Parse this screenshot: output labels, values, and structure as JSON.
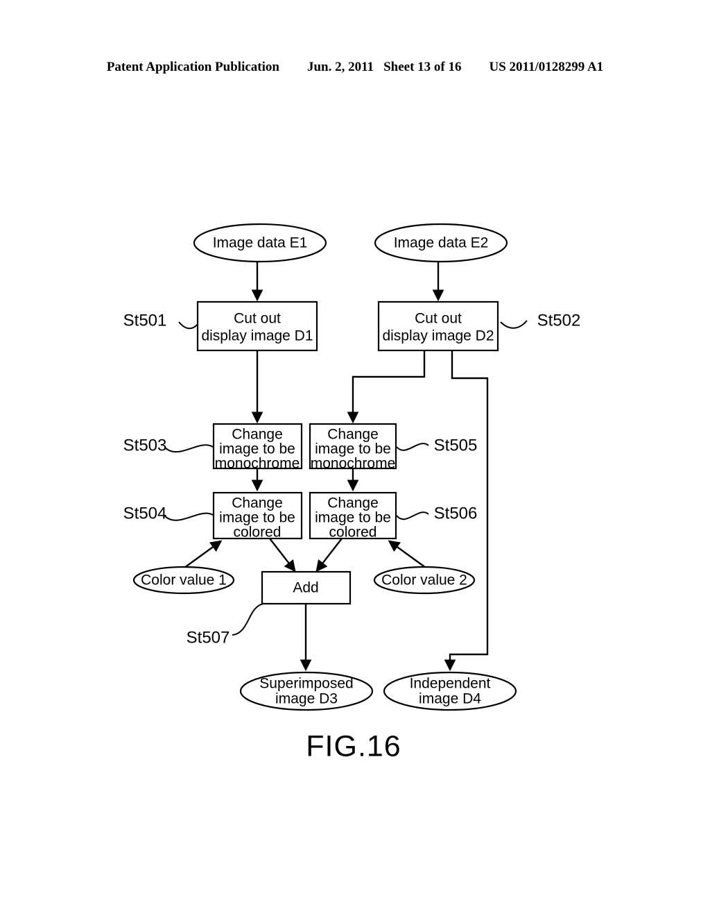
{
  "header": {
    "publication": "Patent Application Publication",
    "date": "Jun. 2, 2011",
    "sheet": "Sheet 13 of 16",
    "number": "US 2011/0128299 A1"
  },
  "figure": {
    "caption": "FIG.16"
  },
  "chart_data": {
    "type": "diagram",
    "title": "FIG.16",
    "nodes": [
      {
        "id": "e1",
        "shape": "ellipse",
        "label": "Image data E1"
      },
      {
        "id": "e2",
        "shape": "ellipse",
        "label": "Image data E2"
      },
      {
        "id": "st501",
        "shape": "rect",
        "label_line1": "Cut out",
        "label_line2": "display image D1",
        "step": "St501"
      },
      {
        "id": "st502",
        "shape": "rect",
        "label_line1": "Cut out",
        "label_line2": "display image D2",
        "step": "St502"
      },
      {
        "id": "st503",
        "shape": "rect",
        "label_line1": "Change",
        "label_line2": "image to be",
        "label_line3": "monochrome",
        "step": "St503"
      },
      {
        "id": "st505",
        "shape": "rect",
        "label_line1": "Change",
        "label_line2": "image to be",
        "label_line3": "monochrome",
        "step": "St505"
      },
      {
        "id": "st504",
        "shape": "rect",
        "label_line1": "Change",
        "label_line2": "image to be",
        "label_line3": "colored",
        "step": "St504"
      },
      {
        "id": "st506",
        "shape": "rect",
        "label_line1": "Change",
        "label_line2": "image to be",
        "label_line3": "colored",
        "step": "St506"
      },
      {
        "id": "cv1",
        "shape": "ellipse",
        "label": "Color value 1"
      },
      {
        "id": "cv2",
        "shape": "ellipse",
        "label": "Color value 2"
      },
      {
        "id": "add",
        "shape": "rect",
        "label": "Add",
        "step": "St507"
      },
      {
        "id": "d3",
        "shape": "ellipse",
        "label_line1": "Superimposed",
        "label_line2": "image D3"
      },
      {
        "id": "d4",
        "shape": "ellipse",
        "label_line1": "Independent",
        "label_line2": "image D4"
      }
    ],
    "edges": [
      {
        "from": "e1",
        "to": "st501"
      },
      {
        "from": "e2",
        "to": "st502"
      },
      {
        "from": "st501",
        "to": "st503"
      },
      {
        "from": "st502",
        "to": "st505"
      },
      {
        "from": "st502",
        "to": "d4"
      },
      {
        "from": "st503",
        "to": "st504"
      },
      {
        "from": "st505",
        "to": "st506"
      },
      {
        "from": "cv1",
        "to": "st504"
      },
      {
        "from": "cv2",
        "to": "st506"
      },
      {
        "from": "st504",
        "to": "add"
      },
      {
        "from": "st506",
        "to": "add"
      },
      {
        "from": "add",
        "to": "d3"
      }
    ]
  },
  "nodes": {
    "e1": {
      "label": "Image data E1"
    },
    "e2": {
      "label": "Image data E2"
    },
    "st501": {
      "step": "St501",
      "line1": "Cut out",
      "line2": "display image D1"
    },
    "st502": {
      "step": "St502",
      "line1": "Cut out",
      "line2": "display image D2"
    },
    "st503": {
      "step": "St503",
      "line1": "Change",
      "line2": "image to be",
      "line3": "monochrome"
    },
    "st505": {
      "step": "St505",
      "line1": "Change",
      "line2": "image to be",
      "line3": "monochrome"
    },
    "st504": {
      "step": "St504",
      "line1": "Change",
      "line2": "image to be",
      "line3": "colored"
    },
    "st506": {
      "step": "St506",
      "line1": "Change",
      "line2": "image to be",
      "line3": "colored"
    },
    "cv1": {
      "label": "Color value 1"
    },
    "cv2": {
      "label": "Color value 2"
    },
    "add": {
      "label": "Add",
      "step": "St507"
    },
    "d3": {
      "line1": "Superimposed",
      "line2": "image D3"
    },
    "d4": {
      "line1": "Independent",
      "line2": "image D4"
    }
  }
}
